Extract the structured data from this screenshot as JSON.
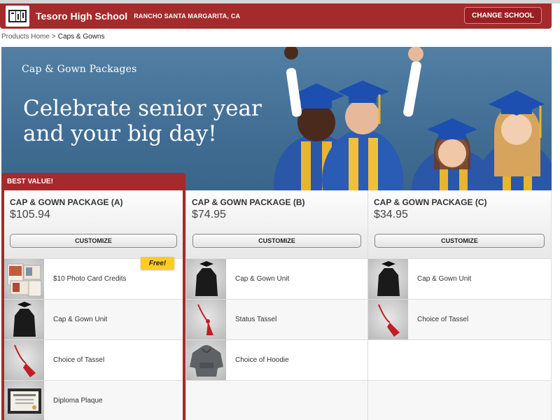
{
  "header": {
    "school_name": "Tesoro High School",
    "location": "RANCHO SANTA MARGARITA, CA",
    "change_school_label": "CHANGE SCHOOL"
  },
  "breadcrumb": {
    "home": "Products Home",
    "separator": ">",
    "current": "Caps & Gowns"
  },
  "hero": {
    "subtitle": "Cap & Gown Packages",
    "title": "Celebrate senior year and your big day!"
  },
  "packages": [
    {
      "badge": "BEST VALUE!",
      "title": "CAP & GOWN PACKAGE (A)",
      "price": "$105.94",
      "customize_label": "CUSTOMIZE",
      "items": [
        {
          "label": "$10 Photo Card Credits",
          "icon": "photo-cards-icon",
          "badge": "Free!"
        },
        {
          "label": "Cap & Gown Unit",
          "icon": "gown-icon"
        },
        {
          "label": "Choice of Tassel",
          "icon": "tassel-icon"
        },
        {
          "label": "Diploma Plaque",
          "icon": "plaque-icon"
        }
      ]
    },
    {
      "title": "CAP & GOWN PACKAGE (B)",
      "price": "$74.95",
      "customize_label": "CUSTOMIZE",
      "items": [
        {
          "label": "Cap & Gown Unit",
          "icon": "gown-icon"
        },
        {
          "label": "Status Tassel",
          "icon": "tassel-icon"
        },
        {
          "label": "Choice of Hoodie",
          "icon": "hoodie-icon"
        }
      ]
    },
    {
      "title": "CAP & GOWN PACKAGE (C)",
      "price": "$34.95",
      "customize_label": "CUSTOMIZE",
      "items": [
        {
          "label": "Cap & Gown Unit",
          "icon": "gown-icon"
        },
        {
          "label": "Choice of Tassel",
          "icon": "tassel-icon"
        }
      ]
    }
  ],
  "colors": {
    "brand_red": "#a52a2c",
    "hero_blue": "#4a769b",
    "free_badge": "#ffcc1f"
  }
}
